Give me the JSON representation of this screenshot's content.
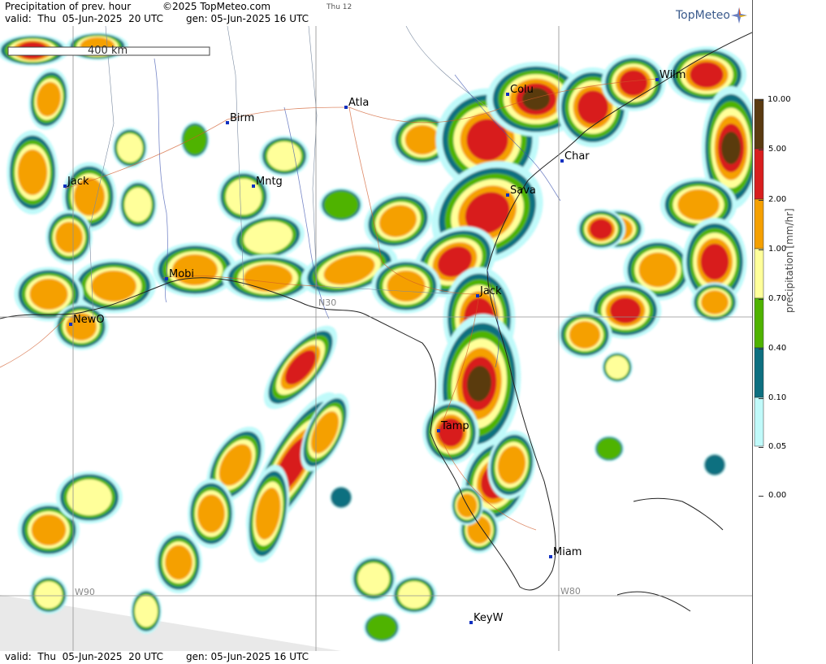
{
  "header": {
    "title": "Precipitation of prev. hour",
    "copyright": "©2025 TopMeteo.com",
    "day_label": "Thu 12",
    "valid": "valid:  Thu  05-Jun-2025  20 UTC",
    "generated": "gen: 05-Jun-2025 16 UTC"
  },
  "footer": {
    "valid": "valid:  Thu  05-Jun-2025  20 UTC",
    "generated": "gen: 05-Jun-2025 16 UTC"
  },
  "logo": {
    "text": "TopMeteo",
    "icon": "compass-star-icon"
  },
  "scale_bar": {
    "label": "400 km"
  },
  "grid_labels": {
    "lat30": "N30",
    "lon90": "W90",
    "lon80": "W80",
    "lat25": "W90"
  },
  "cities": [
    {
      "name": "Colu"
    },
    {
      "name": "Wilm"
    },
    {
      "name": "Atla"
    },
    {
      "name": "Birm"
    },
    {
      "name": "Char"
    },
    {
      "name": "Jack"
    },
    {
      "name": "Mntg"
    },
    {
      "name": "Sava"
    },
    {
      "name": "Mobi"
    },
    {
      "name": "Jack"
    },
    {
      "name": "NewO"
    },
    {
      "name": "Tamp"
    },
    {
      "name": "Miam"
    },
    {
      "name": "KeyW"
    }
  ],
  "legend": {
    "unit_label": "precipitation  [mm/hr]",
    "levels": [
      "10.00",
      "5.00",
      "2.00",
      "1.00",
      "0.70",
      "0.40",
      "0.10",
      "0.05",
      "0.00"
    ],
    "colors": [
      "#5a3a10",
      "#d81e1e",
      "#f5a000",
      "#ffff9a",
      "#4fb300",
      "#0d6f80",
      "#c0fafa",
      "#ffffff"
    ]
  }
}
